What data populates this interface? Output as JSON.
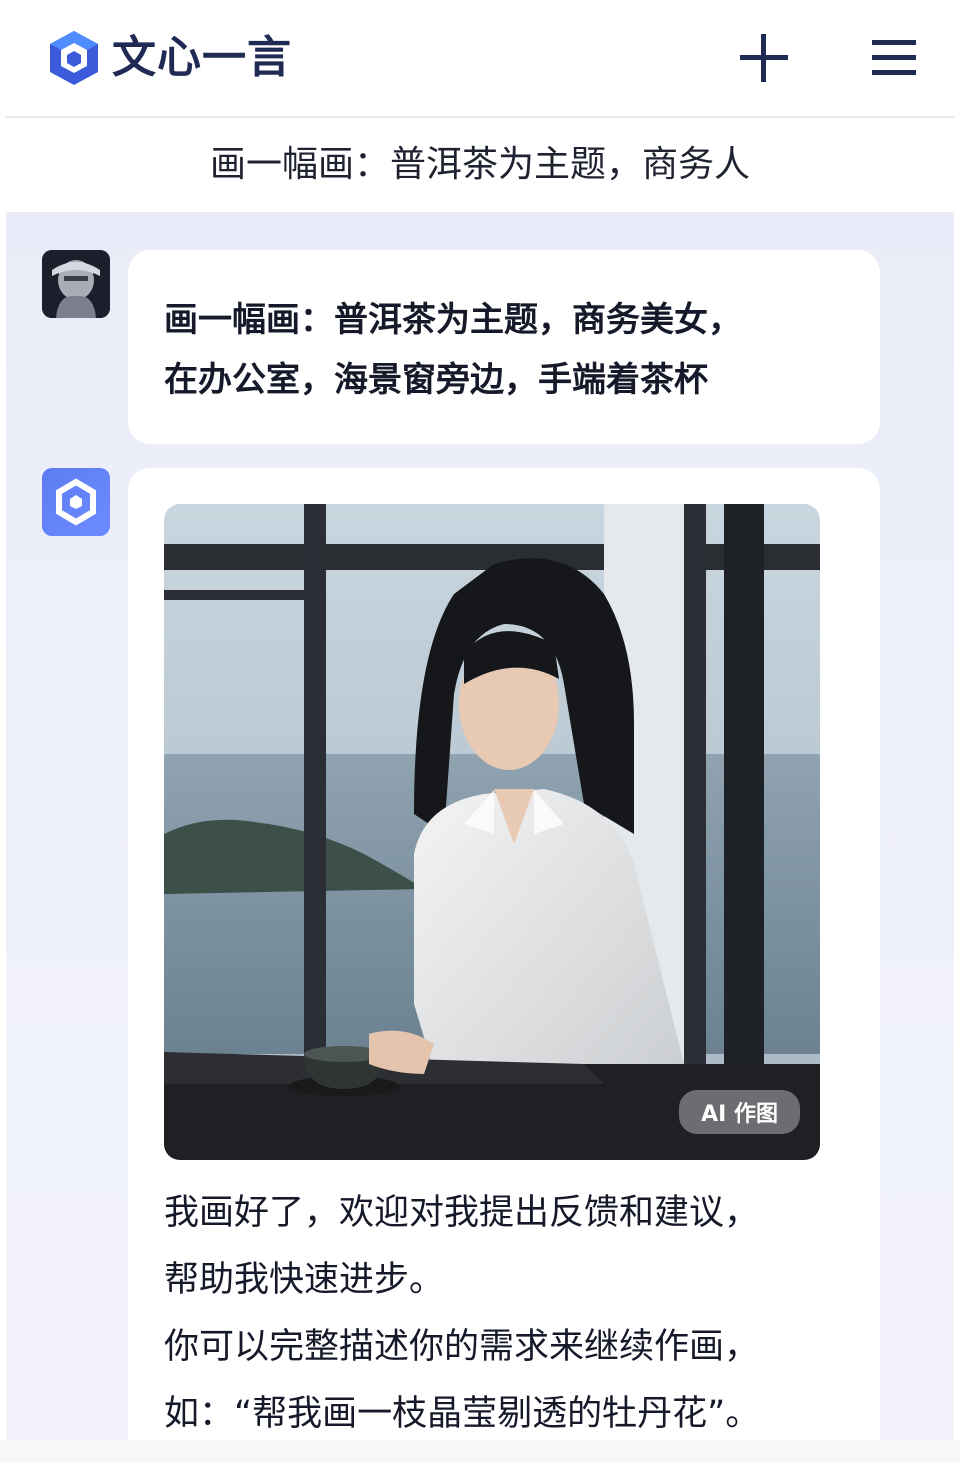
{
  "header": {
    "app_name": "文心一言",
    "new_chat_icon": "plus-icon",
    "menu_icon": "hamburger-menu-icon"
  },
  "conversation": {
    "title": "画一幅画：普洱茶为主题，商务人"
  },
  "messages": [
    {
      "role": "user",
      "avatar": "user-avatar",
      "lines": [
        "画一幅画：普洱茶为主题，商务美女，",
        "在办公室，海景窗旁边，手端着茶杯"
      ]
    },
    {
      "role": "assistant",
      "avatar": "ernie-bot-avatar",
      "image_tag": "AI 作图",
      "lines": [
        "我画好了，欢迎对我提出反馈和建议，",
        "帮助我快速进步。",
        "你可以完整描述你的需求来继续作画，",
        "如：“帮我画一枝晶莹剔透的牡丹花”。"
      ]
    }
  ],
  "colors": {
    "brand_blue": "#3b5bdb",
    "chat_background": "#eceefa",
    "bubble": "#ffffff",
    "text": "#16192a"
  }
}
